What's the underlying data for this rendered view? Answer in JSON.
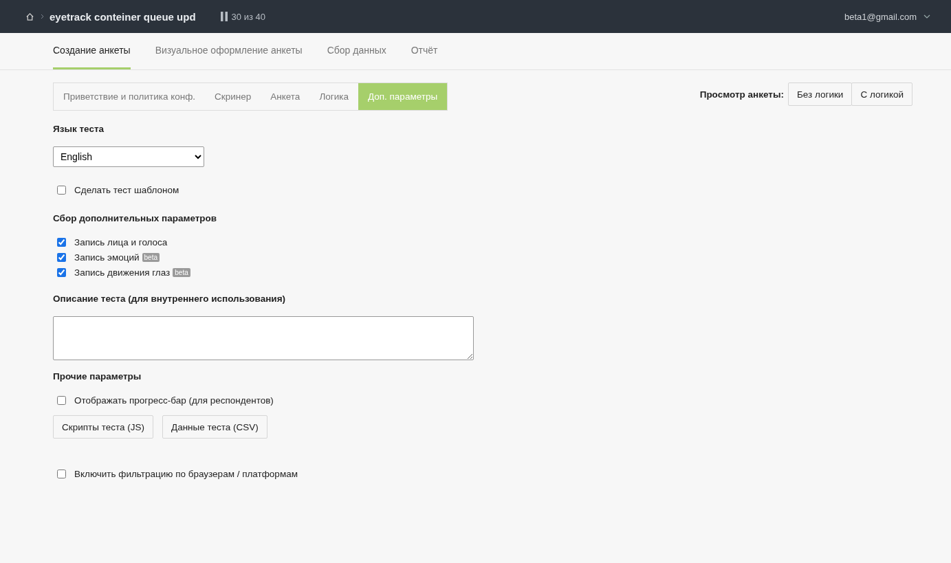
{
  "header": {
    "title": "eyetrack conteiner queue upd",
    "progress": "30 из 40",
    "user": "beta1@gmail.com"
  },
  "main_tabs": [
    {
      "label": "Создание анкеты",
      "selected": true
    },
    {
      "label": "Визуальное оформление анкеты",
      "selected": false
    },
    {
      "label": "Сбор данных",
      "selected": false
    },
    {
      "label": "Отчёт",
      "selected": false
    }
  ],
  "sub_tabs": [
    {
      "label": "Приветствие и политика конф.",
      "selected": false
    },
    {
      "label": "Скринер",
      "selected": false
    },
    {
      "label": "Анкета",
      "selected": false
    },
    {
      "label": "Логика",
      "selected": false
    },
    {
      "label": "Доп. параметры",
      "selected": true
    }
  ],
  "preview": {
    "label": "Просмотр анкеты:",
    "buttons": [
      "Без логики",
      "С логикой"
    ]
  },
  "language": {
    "label": "Язык теста",
    "value": "English"
  },
  "template_checkbox": {
    "label": "Сделать тест шаблоном",
    "checked": false
  },
  "extra_params": {
    "title": "Сбор дополнительных параметров",
    "items": [
      {
        "label": "Запись лица и голоса",
        "checked": true
      },
      {
        "label": "Запись эмоций",
        "checked": true,
        "badge": "beta"
      },
      {
        "label": "Запись движения глаз",
        "checked": true,
        "badge": "beta"
      }
    ]
  },
  "description": {
    "label": "Описание теста (для внутреннего использования)"
  },
  "other": {
    "title": "Прочие параметры",
    "progress_checkbox": {
      "label": "Отображать прогресс-бар (для респондентов)",
      "checked": false
    },
    "buttons": [
      "Скрипты теста (JS)",
      "Данные теста (CSV)"
    ]
  },
  "filter_checkbox": {
    "label": "Включить фильтрацию по браузерам / платформам",
    "checked": false
  }
}
